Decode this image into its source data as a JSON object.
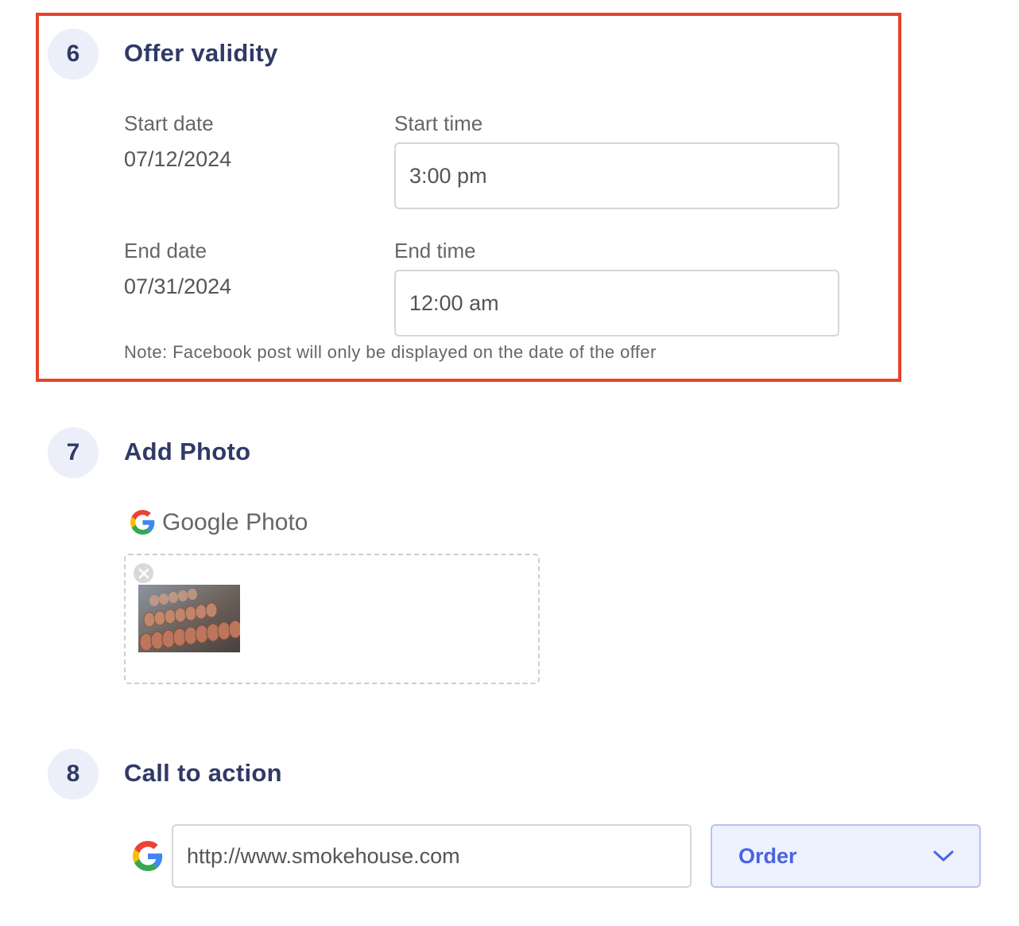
{
  "sections": [
    {
      "number": "6",
      "title": "Offer validity"
    },
    {
      "number": "7",
      "title": "Add Photo"
    },
    {
      "number": "8",
      "title": "Call to action"
    }
  ],
  "offer_validity": {
    "start_date_label": "Start date",
    "start_date_value": "07/12/2024",
    "start_time_label": "Start time",
    "start_time_value": "3:00 pm",
    "end_date_label": "End date",
    "end_date_value": "07/31/2024",
    "end_time_label": "End time",
    "end_time_value": "12:00 am",
    "note": "Note: Facebook post will only be displayed on the date of the offer",
    "highlight_color": "#e4432b"
  },
  "add_photo": {
    "source_label": "Google Photo",
    "source_icon": "google-logo-icon",
    "remove_icon": "close-circle-icon"
  },
  "call_to_action": {
    "url_value": "http://www.smokehouse.com",
    "action_selected": "Order",
    "source_icon": "google-logo-icon",
    "dropdown_icon": "chevron-down-icon"
  },
  "colors": {
    "title": "#2f3a66",
    "badge_bg": "#eceff9",
    "select_bg": "#eef1fe",
    "select_text": "#4a63e0"
  }
}
